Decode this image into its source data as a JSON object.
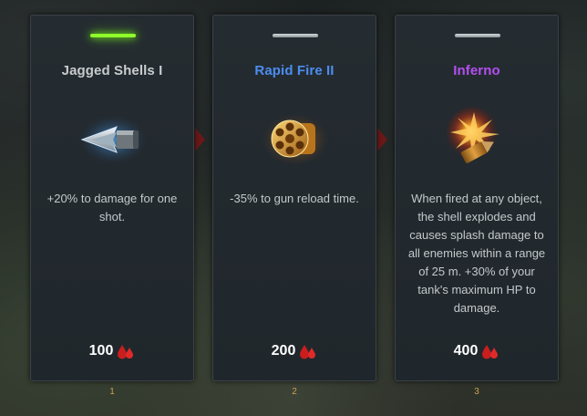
{
  "cards": [
    {
      "title": "Jagged Shells I",
      "title_color": "#c8ccce",
      "selected": true,
      "icon": "jagged-shell-icon",
      "description": "+20% to damage for one shot.",
      "cost": "100",
      "cost_icon": "blood-drops-icon",
      "index": "1"
    },
    {
      "title": "Rapid Fire II",
      "title_color": "#4b8df0",
      "selected": false,
      "icon": "revolver-cylinder-icon",
      "description": "-35% to gun reload time.",
      "cost": "200",
      "cost_icon": "blood-drops-icon",
      "index": "2"
    },
    {
      "title": "Inferno",
      "title_color": "#b44ff0",
      "selected": false,
      "icon": "exploding-shell-icon",
      "description": "When fired at any object, the shell explodes and causes splash damage to all enemies within a range of 25 m. +30% of your tank's maximum HP to damage.",
      "cost": "400",
      "cost_icon": "blood-drops-icon",
      "index": "3"
    }
  ],
  "colors": {
    "selected_indicator": "#8fff2a",
    "cost_icon": "#c81e1e",
    "index_text": "#c9a14a"
  }
}
